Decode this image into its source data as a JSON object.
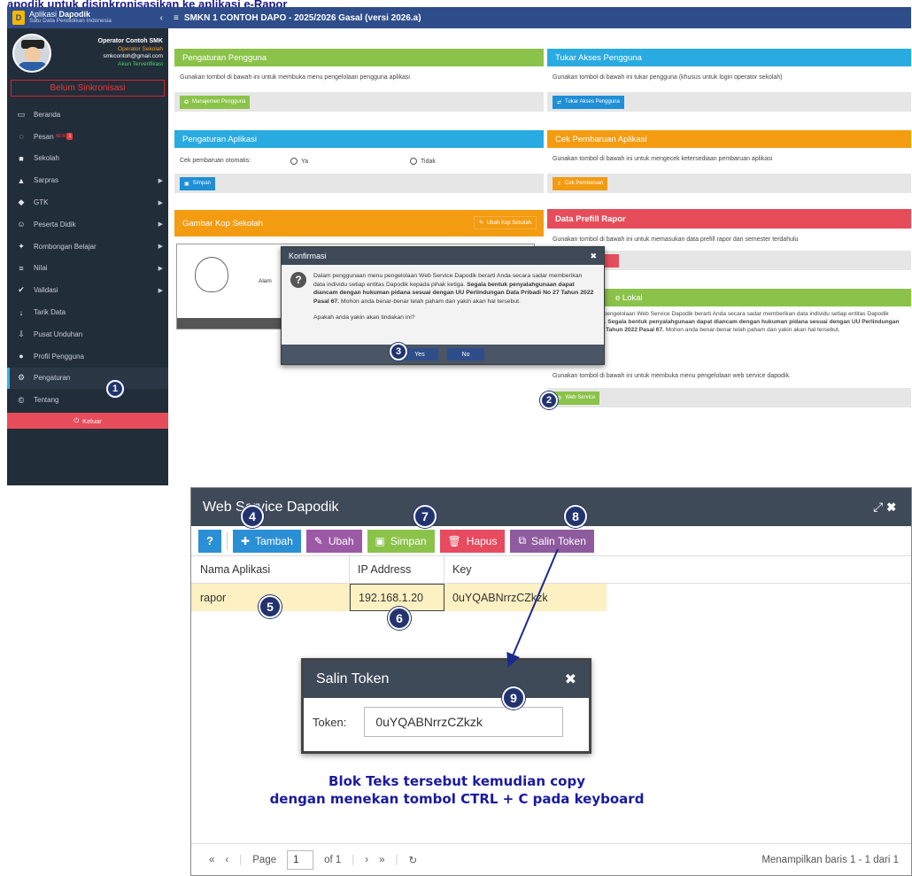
{
  "doc_title": "apodik untuk disinkronisasikan ke aplikasi e-Rapor",
  "app": {
    "brand_prefix": "Aplikasi ",
    "brand_strong": "Dapodik",
    "brand_sub": "Satu Data Pendidikan Indonesia",
    "header_title": "SMKN 1 CONTOH DAPO - 2025/2026 Gasal (versi 2026.a)"
  },
  "user": {
    "name": "Operator Contoh SMK",
    "role": "Operator Sekolah",
    "email": "smkcontoh@gmail.com",
    "status": "Akun Terverifikasi"
  },
  "sync_status": "Belum Sinkronisasi",
  "menu": [
    {
      "label": "Beranda",
      "icon": "▭",
      "name": "beranda"
    },
    {
      "label": "Pesan",
      "icon": "◌",
      "name": "pesan",
      "new": "NEW",
      "badge": "1"
    },
    {
      "label": "Sekolah",
      "icon": "■",
      "name": "sekolah"
    },
    {
      "label": "Sarpras",
      "icon": "▲",
      "name": "sarpras",
      "arrow": true
    },
    {
      "label": "GTK",
      "icon": "◆",
      "name": "gtk",
      "arrow": true
    },
    {
      "label": "Peserta Didik",
      "icon": "☺",
      "name": "peserta-didik",
      "arrow": true
    },
    {
      "label": "Rombongan Belajar",
      "icon": "✦",
      "name": "rombongan-belajar",
      "arrow": true
    },
    {
      "label": "Nilai",
      "icon": "≡",
      "name": "nilai",
      "arrow": true
    },
    {
      "label": "Validasi",
      "icon": "✔",
      "name": "validasi",
      "arrow": true
    },
    {
      "label": "Tarik Data",
      "icon": "↓",
      "name": "tarik-data"
    },
    {
      "label": "Pusat Unduhan",
      "icon": "⇩",
      "name": "pusat-unduhan"
    },
    {
      "label": "Profil Pengguna",
      "icon": "●",
      "name": "profil-pengguna"
    },
    {
      "label": "Pengaturan",
      "icon": "⚙",
      "name": "pengaturan",
      "active": true
    },
    {
      "label": "Tentang",
      "icon": "©",
      "name": "tentang"
    }
  ],
  "logout_label": "Keluar",
  "panels": {
    "pengguna": {
      "title": "Pengaturan Pengguna",
      "desc": "Gunakan tombol di bawah ini untuk membuka menu pengelolaan pengguna aplikasi",
      "button": "Manajemen Pengguna"
    },
    "aplikasi": {
      "title": "Pengaturan Aplikasi",
      "label": "Cek pembaruan otomatis:",
      "opt_yes": "Ya",
      "opt_no": "Tidak",
      "button": "Simpan"
    },
    "kop": {
      "title": "Gambar Kop Sekolah",
      "button": "Ubah Kop Sekolah",
      "text_frag": "Alam"
    },
    "tukar": {
      "title": "Tukar Akses Pengguna",
      "desc": "Gunakan tombol di bawah ini tukar pengguna (khusus untuk login operator sekolah)",
      "button": "Tukar Akses Pengguna"
    },
    "cek": {
      "title": "Cek Pembaruan Aplikasi",
      "desc": "Gunakan tombol di bawah ini untuk mengecek ketersediaan pembaruan aplikasi",
      "button": "Cek Pembaruan"
    },
    "prefill": {
      "title": "Data Prefill Rapor",
      "desc": "Gunakan tombol di bawah ini untuk memasukan data prefill rapor dari semester terdahulu"
    },
    "ws": {
      "title": "e Lokal",
      "desc_start": "Penggunaan menu pengelolaan Web Service Dapodik berarti Anda secara sadar memberikan data individu setiap entitas Dapodik kepada pihak ketiga. ",
      "desc_bold": "Segala bentuk penyalahgunaan dapat diancam dengan hukuman pidana sesuai dengan UU Perlindungan Data Pribadi No 27 Tahun 2022 Pasal 67.",
      "desc_end": " Mohon anda benar-benar telah paham dan yakin akan hal tersebut.",
      "desc2": "Gunakan tombol di bawah ini untuk membuka menu pengelolaan web service dapodik.",
      "button": "Web Service"
    }
  },
  "konfirmasi": {
    "title": "Konfirmasi",
    "text_start": "Dalam penggunaan menu pengelolaan Web Service Dapodik berarti Anda secara sadar memberikan data individu setiap entitas Dapodik kepada pihak ketiga. ",
    "text_bold": "Segala bentuk penyalahgunaan dapat diancam dengan hukuman pidana sesuai dengan UU Perlindungan Data Pribadi No 27 Tahun 2022 Pasal 67.",
    "text_end": " Mohon anda benar-benar telah paham dan yakin akan hal tersebut.",
    "question": "Apakah anda yakin akan tindakan ini?",
    "yes": "Yes",
    "no": "No"
  },
  "web_service": {
    "title": "Web Service Dapodik",
    "toolbar": {
      "add": "Tambah",
      "edit": "Ubah",
      "save": "Simpan",
      "delete": "Hapus",
      "copy_token": "Salin Token"
    },
    "columns": [
      "Nama Aplikasi",
      "IP Address",
      "Key"
    ],
    "row": {
      "name": "rapor",
      "ip": "192.168.1.20",
      "key": "0uYQABNrrzCZkzk"
    },
    "pager": {
      "page_label": "Page",
      "page": "1",
      "of": "of 1",
      "info": "Menampilkan baris 1 - 1 dari 1"
    }
  },
  "salin_token": {
    "title": "Salin Token",
    "label": "Token:",
    "value": "0uYQABNrrzCZkzk"
  },
  "instruction": [
    "Blok Teks tersebut kemudian copy",
    "dengan menekan tombol CTRL + C pada keyboard"
  ],
  "markers": [
    "1",
    "2",
    "3",
    "4",
    "5",
    "6",
    "7",
    "8",
    "9"
  ],
  "colors": {
    "header_blue": "#2e4d8a",
    "sidebar": "#222d3a",
    "green": "#8bc34a",
    "sky": "#29abe2",
    "orange": "#f39c12",
    "red": "#e74c5a",
    "marker": "#22336e"
  }
}
